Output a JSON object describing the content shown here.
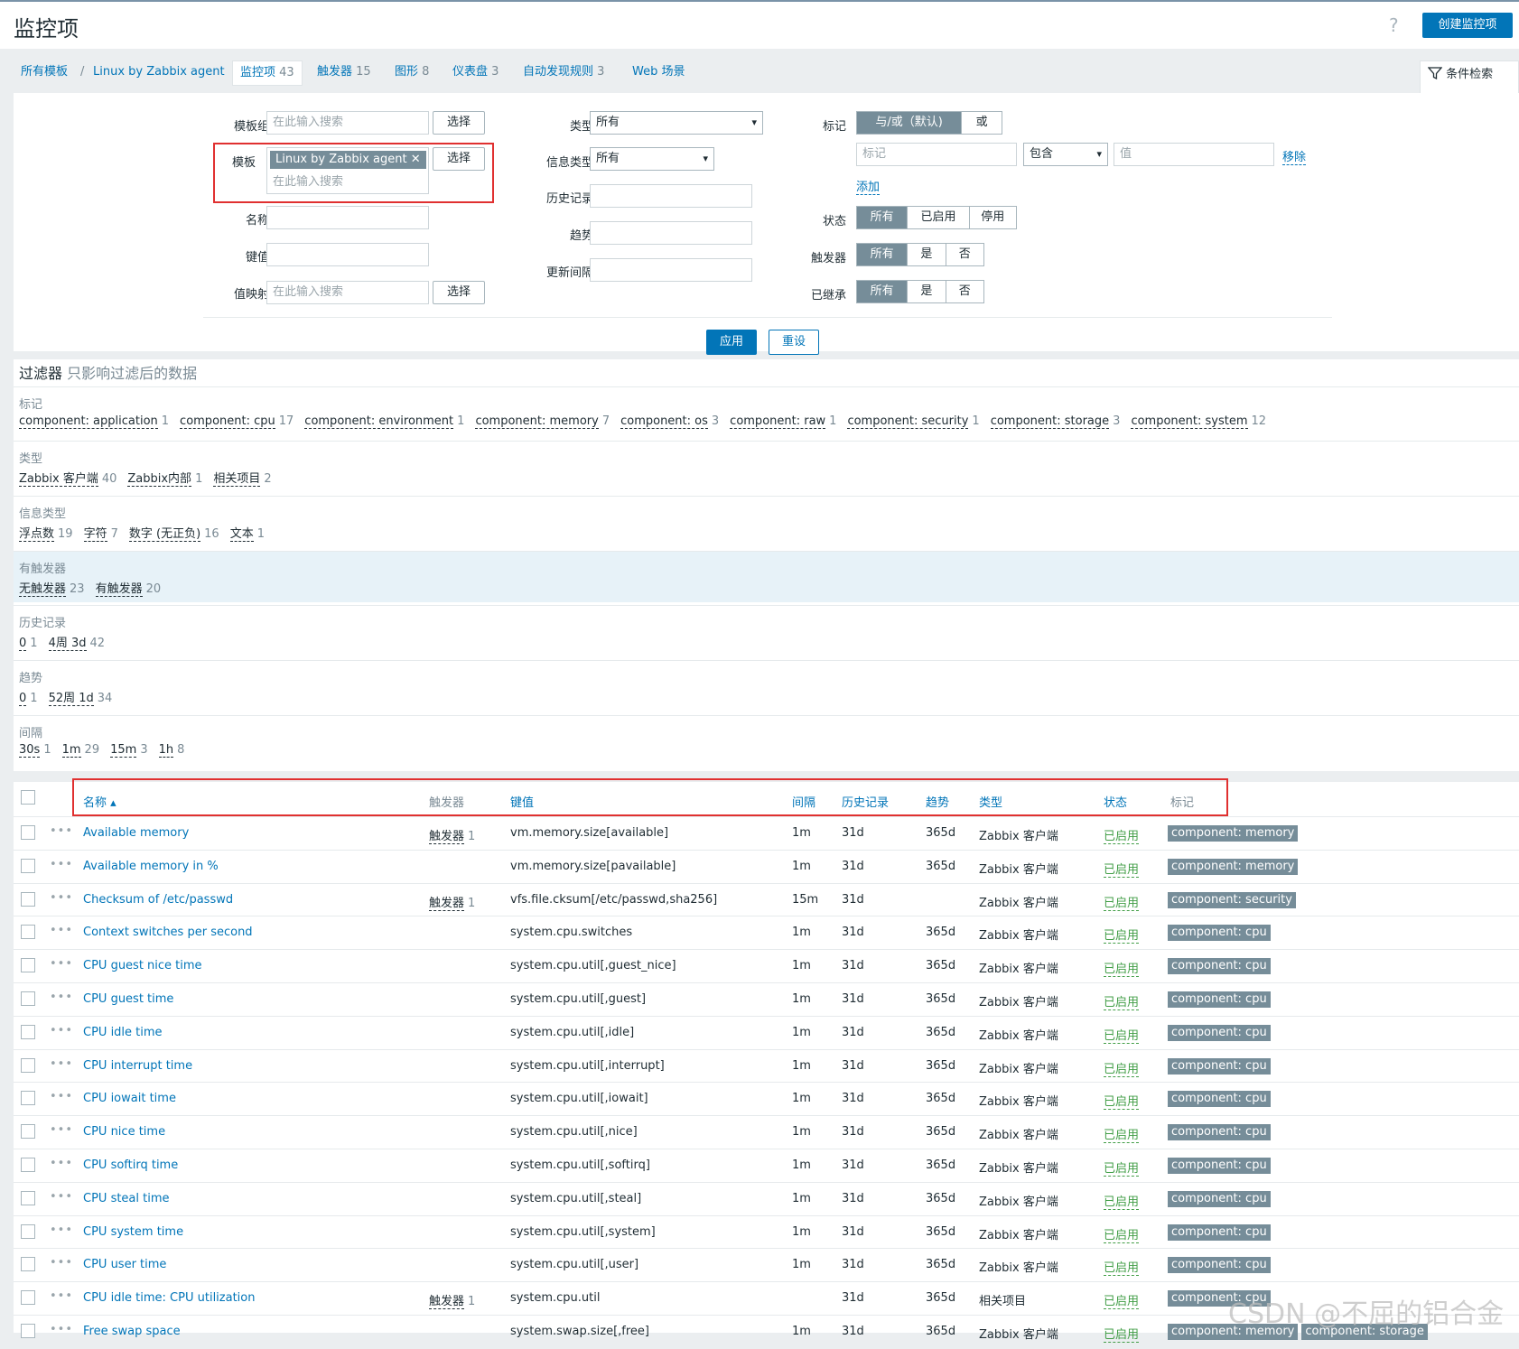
{
  "header": {
    "title": "监控项",
    "help": "?",
    "create_button": "创建监控项"
  },
  "nav": {
    "all_templates": "所有模板",
    "separator": "/",
    "template": "Linux by Zabbix agent",
    "tabs": [
      {
        "label": "监控项",
        "count": "43"
      },
      {
        "label": "触发器",
        "count": "15"
      },
      {
        "label": "图形",
        "count": "8"
      },
      {
        "label": "仪表盘",
        "count": "3"
      },
      {
        "label": "自动发现规则",
        "count": "3"
      },
      {
        "label": "Web 场景",
        "count": ""
      }
    ],
    "filter_tab": "条件检索"
  },
  "filter": {
    "template_group_label": "模板组",
    "template_label": "模板",
    "name_label": "名称",
    "key_label": "键值",
    "valuemap_label": "值映射",
    "search_placeholder": "在此输入搜索",
    "select_button": "选择",
    "template_chip": "Linux by Zabbix agent",
    "type_label": "类型",
    "type_value": "所有",
    "info_type_label": "信息类型",
    "info_type_value": "所有",
    "history_label": "历史记录",
    "trends_label": "趋势",
    "interval_label": "更新间隔",
    "tags_label": "标记",
    "tags_and": "与/或（默认)",
    "tags_or": "或",
    "tag_placeholder": "标记",
    "tag_op": "包含",
    "value_placeholder": "值",
    "remove": "移除",
    "add": "添加",
    "state_label": "状态",
    "state_options": [
      "所有",
      "已启用",
      "停用"
    ],
    "triggers_label": "触发器",
    "inherited_label": "已继承",
    "yes_no": [
      "所有",
      "是",
      "否"
    ],
    "apply": "应用",
    "reset": "重设"
  },
  "overview": {
    "title": "过滤器",
    "subtitle": "只影响过滤后的数据",
    "sections": [
      {
        "title": "标记",
        "items": [
          {
            "name": "component: application",
            "count": "1"
          },
          {
            "name": "component: cpu",
            "count": "17"
          },
          {
            "name": "component: environment",
            "count": "1"
          },
          {
            "name": "component: memory",
            "count": "7"
          },
          {
            "name": "component: os",
            "count": "3"
          },
          {
            "name": "component: raw",
            "count": "1"
          },
          {
            "name": "component: security",
            "count": "1"
          },
          {
            "name": "component: storage",
            "count": "3"
          },
          {
            "name": "component: system",
            "count": "12"
          }
        ]
      },
      {
        "title": "类型",
        "items": [
          {
            "name": "Zabbix 客户端",
            "count": "40"
          },
          {
            "name": "Zabbix内部",
            "count": "1"
          },
          {
            "name": "相关项目",
            "count": "2"
          }
        ]
      },
      {
        "title": "信息类型",
        "items": [
          {
            "name": "浮点数",
            "count": "19"
          },
          {
            "name": "字符",
            "count": "7"
          },
          {
            "name": "数字 (无正负)",
            "count": "16"
          },
          {
            "name": "文本",
            "count": "1"
          }
        ]
      },
      {
        "title": "有触发器",
        "items": [
          {
            "name": "无触发器",
            "count": "23"
          },
          {
            "name": "有触发器",
            "count": "20"
          }
        ]
      },
      {
        "title": "历史记录",
        "items": [
          {
            "name": "0",
            "count": "1"
          },
          {
            "name": "4周 3d",
            "count": "42"
          }
        ]
      },
      {
        "title": "趋势",
        "items": [
          {
            "name": "0",
            "count": "1"
          },
          {
            "name": "52周 1d",
            "count": "34"
          }
        ]
      },
      {
        "title": "间隔",
        "items": [
          {
            "name": "30s",
            "count": "1"
          },
          {
            "name": "1m",
            "count": "29"
          },
          {
            "name": "15m",
            "count": "3"
          },
          {
            "name": "1h",
            "count": "8"
          }
        ]
      }
    ]
  },
  "table": {
    "headers": {
      "name": "名称 ▴",
      "triggers": "触发器",
      "key": "键值",
      "interval": "间隔",
      "history": "历史记录",
      "trends": "趋势",
      "type": "类型",
      "status": "状态",
      "tags": "标记"
    },
    "dots": "•••",
    "trigger_word": "触发器",
    "rows": [
      {
        "name": "Available memory",
        "triggers": "1",
        "key": "vm.memory.size[available]",
        "interval": "1m",
        "history": "31d",
        "trends": "365d",
        "type": "Zabbix 客户端",
        "status": "已启用",
        "tags": [
          "component: memory"
        ]
      },
      {
        "name": "Available memory in %",
        "triggers": "",
        "key": "vm.memory.size[pavailable]",
        "interval": "1m",
        "history": "31d",
        "trends": "365d",
        "type": "Zabbix 客户端",
        "status": "已启用",
        "tags": [
          "component: memory"
        ]
      },
      {
        "name": "Checksum of /etc/passwd",
        "triggers": "1",
        "key": "vfs.file.cksum[/etc/passwd,sha256]",
        "interval": "15m",
        "history": "31d",
        "trends": "",
        "type": "Zabbix 客户端",
        "status": "已启用",
        "tags": [
          "component: security"
        ]
      },
      {
        "name": "Context switches per second",
        "triggers": "",
        "key": "system.cpu.switches",
        "interval": "1m",
        "history": "31d",
        "trends": "365d",
        "type": "Zabbix 客户端",
        "status": "已启用",
        "tags": [
          "component: cpu"
        ]
      },
      {
        "name": "CPU guest nice time",
        "triggers": "",
        "key": "system.cpu.util[,guest_nice]",
        "interval": "1m",
        "history": "31d",
        "trends": "365d",
        "type": "Zabbix 客户端",
        "status": "已启用",
        "tags": [
          "component: cpu"
        ]
      },
      {
        "name": "CPU guest time",
        "triggers": "",
        "key": "system.cpu.util[,guest]",
        "interval": "1m",
        "history": "31d",
        "trends": "365d",
        "type": "Zabbix 客户端",
        "status": "已启用",
        "tags": [
          "component: cpu"
        ]
      },
      {
        "name": "CPU idle time",
        "triggers": "",
        "key": "system.cpu.util[,idle]",
        "interval": "1m",
        "history": "31d",
        "trends": "365d",
        "type": "Zabbix 客户端",
        "status": "已启用",
        "tags": [
          "component: cpu"
        ]
      },
      {
        "name": "CPU interrupt time",
        "triggers": "",
        "key": "system.cpu.util[,interrupt]",
        "interval": "1m",
        "history": "31d",
        "trends": "365d",
        "type": "Zabbix 客户端",
        "status": "已启用",
        "tags": [
          "component: cpu"
        ]
      },
      {
        "name": "CPU iowait time",
        "triggers": "",
        "key": "system.cpu.util[,iowait]",
        "interval": "1m",
        "history": "31d",
        "trends": "365d",
        "type": "Zabbix 客户端",
        "status": "已启用",
        "tags": [
          "component: cpu"
        ]
      },
      {
        "name": "CPU nice time",
        "triggers": "",
        "key": "system.cpu.util[,nice]",
        "interval": "1m",
        "history": "31d",
        "trends": "365d",
        "type": "Zabbix 客户端",
        "status": "已启用",
        "tags": [
          "component: cpu"
        ]
      },
      {
        "name": "CPU softirq time",
        "triggers": "",
        "key": "system.cpu.util[,softirq]",
        "interval": "1m",
        "history": "31d",
        "trends": "365d",
        "type": "Zabbix 客户端",
        "status": "已启用",
        "tags": [
          "component: cpu"
        ]
      },
      {
        "name": "CPU steal time",
        "triggers": "",
        "key": "system.cpu.util[,steal]",
        "interval": "1m",
        "history": "31d",
        "trends": "365d",
        "type": "Zabbix 客户端",
        "status": "已启用",
        "tags": [
          "component: cpu"
        ]
      },
      {
        "name": "CPU system time",
        "triggers": "",
        "key": "system.cpu.util[,system]",
        "interval": "1m",
        "history": "31d",
        "trends": "365d",
        "type": "Zabbix 客户端",
        "status": "已启用",
        "tags": [
          "component: cpu"
        ]
      },
      {
        "name": "CPU user time",
        "triggers": "",
        "key": "system.cpu.util[,user]",
        "interval": "1m",
        "history": "31d",
        "trends": "365d",
        "type": "Zabbix 客户端",
        "status": "已启用",
        "tags": [
          "component: cpu"
        ]
      },
      {
        "name": "CPU idle time: CPU utilization",
        "triggers": "1",
        "key": "system.cpu.util",
        "interval": "",
        "history": "31d",
        "trends": "365d",
        "type": "相关项目",
        "status": "已启用",
        "tags": [
          "component: cpu"
        ]
      },
      {
        "name": "Free swap space",
        "triggers": "",
        "key": "system.swap.size[,free]",
        "interval": "1m",
        "history": "31d",
        "trends": "365d",
        "type": "Zabbix 客户端",
        "status": "已启用",
        "tags": [
          "component: memory",
          "component: storage"
        ]
      }
    ]
  },
  "watermark": "CSDN @不屈的铝合金",
  "colors": {
    "link": "#0275b8",
    "enabled": "#429e47",
    "tag_bg": "#768d99",
    "highlight": "#e03030"
  }
}
